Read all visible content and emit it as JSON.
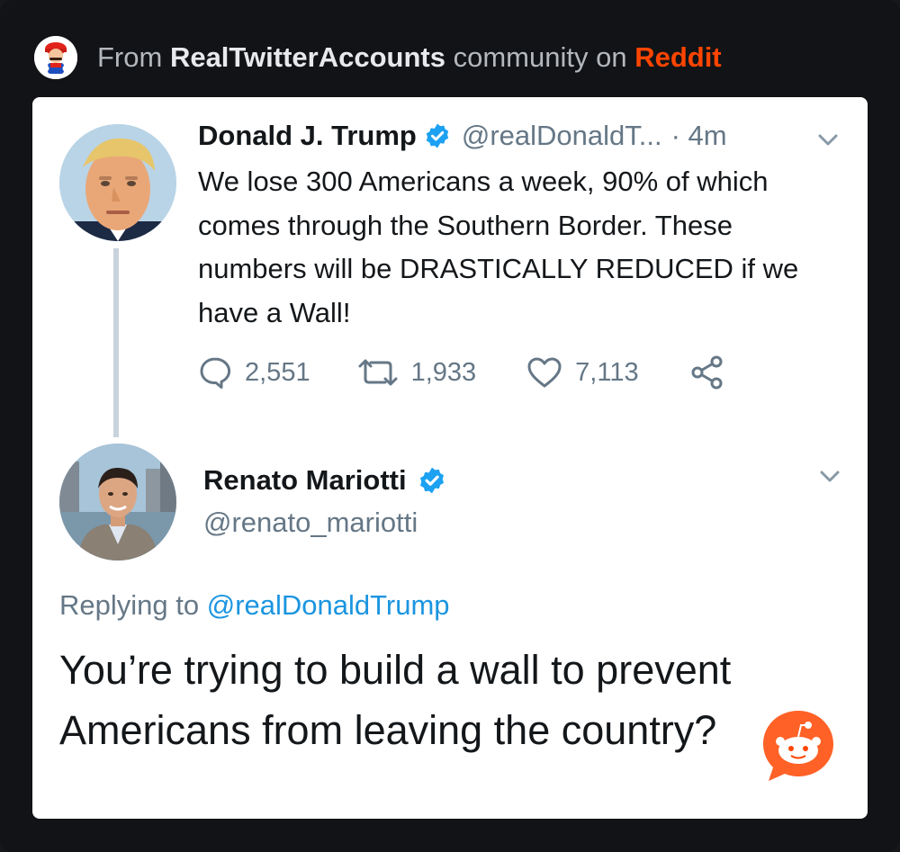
{
  "header": {
    "prefix": "From ",
    "community": "RealTwitterAccounts",
    "middle": " community on ",
    "brand": "Reddit",
    "avatar_icon": "mario-avatar-icon"
  },
  "colors": {
    "brand": "#ff4500",
    "verified": "#1da1f2",
    "mention": "#1b95e0",
    "muted": "#657786"
  },
  "tweet": {
    "name": "Donald J. Trump",
    "handle": "@realDonaldT...",
    "time": "· 4m",
    "text": "We lose 300 Americans a week, 90% of which comes through the Southern Border. These numbers will be DRASTICALLY REDUCED if we have a Wall!",
    "replies": "2,551",
    "retweets": "1,933",
    "likes": "7,113"
  },
  "reply": {
    "name": "Renato Mariotti",
    "handle": "@renato_mariotti",
    "replying_prefix": "Replying to ",
    "replying_to": "@realDonaldTrump",
    "text": "You’re trying to build a wall to prevent Americans from leaving the country?"
  }
}
